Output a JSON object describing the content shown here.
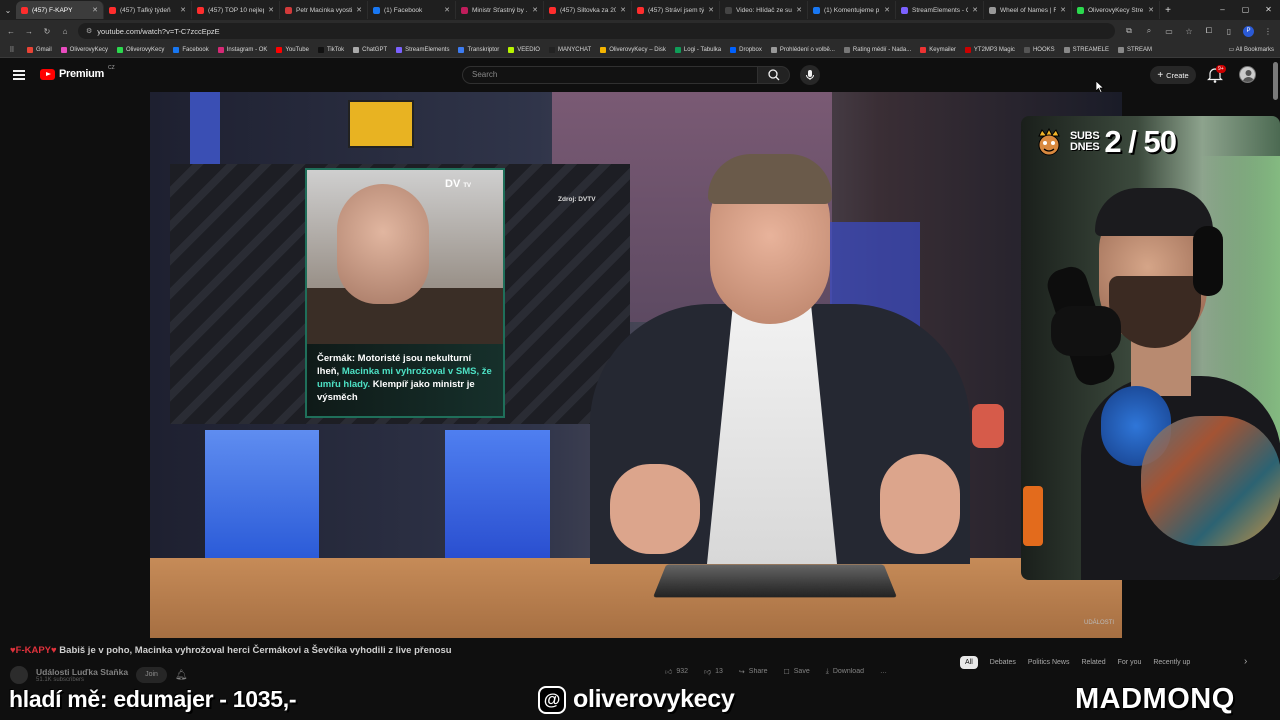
{
  "browser": {
    "tabs": [
      {
        "title": "(457) F-KAPY",
        "color": "#ff2d2d",
        "active": true
      },
      {
        "title": "(457) Ťafký týdeň",
        "color": "#ff2d2d"
      },
      {
        "title": "(457) TOP 10 nejlepš",
        "color": "#ff2d2d"
      },
      {
        "title": "Petr Macinka vyosti",
        "color": "#d23a3a"
      },
      {
        "title": "(1) Facebook",
        "color": "#1877f2"
      },
      {
        "title": "Ministr Šťastný by ...",
        "color": "#c01d5b"
      },
      {
        "title": "(457) Šiltovka za 20",
        "color": "#ff2d2d"
      },
      {
        "title": "(457) Stráví jsem tý",
        "color": "#ff2d2d"
      },
      {
        "title": "Video: Hlídač ze sup",
        "color": "#444"
      },
      {
        "title": "(1) Komentujeme p",
        "color": "#1877f2"
      },
      {
        "title": "StreamElements - C",
        "color": "#7b61ff"
      },
      {
        "title": "Wheel of Names | F",
        "color": "#999"
      },
      {
        "title": "OliverovyKecy Stre",
        "color": "#2bd94e"
      }
    ],
    "new_tab_label": "+",
    "window_controls": [
      "–",
      "▢",
      "✕"
    ],
    "url": "youtube.com/watch?v=T-C7zccEpzE",
    "bookmarks": [
      {
        "label": "Gmail",
        "color": "#ea4335"
      },
      {
        "label": "OliverovyKecy",
        "color": "#ea4cc0"
      },
      {
        "label": "OliverovyKecy",
        "color": "#2bd94e"
      },
      {
        "label": "Facebook",
        "color": "#1877f2"
      },
      {
        "label": "Instagram - OK",
        "color": "#d62976"
      },
      {
        "label": "YouTube",
        "color": "#ff0000"
      },
      {
        "label": "TikTok",
        "color": "#111"
      },
      {
        "label": "ChatGPT",
        "color": "#aaa"
      },
      {
        "label": "StreamElements",
        "color": "#7b61ff"
      },
      {
        "label": "Transkriptor",
        "color": "#3d7cf2"
      },
      {
        "label": "VEEDIO",
        "color": "#b8f500"
      },
      {
        "label": "MANYCHAT",
        "color": "#222"
      },
      {
        "label": "OliverovyKecy – Disk",
        "color": "#f4b400"
      },
      {
        "label": "Logi - Tabulka",
        "color": "#0f9d58"
      },
      {
        "label": "Dropbox",
        "color": "#0061ff"
      },
      {
        "label": "Prohlédení o volbě...",
        "color": "#999"
      },
      {
        "label": "Rating médií - Nada...",
        "color": "#777"
      },
      {
        "label": "Keymailer",
        "color": "#e33"
      },
      {
        "label": "YT2MP3 Magic",
        "color": "#c00"
      },
      {
        "label": "HOOKS",
        "color": "#555"
      },
      {
        "label": "STREAMELE",
        "color": "#888"
      },
      {
        "label": "STREAM",
        "color": "#888"
      }
    ],
    "all_bookmarks": "All Bookmarks"
  },
  "youtube": {
    "logo_text": "Premium",
    "logo_country": "CZ",
    "search_placeholder": "Search",
    "create_label": "Create",
    "notif_count": "9+",
    "video": {
      "tv_logo": "DV",
      "tv_logo_small": "TV",
      "source": "Zdroj: DVTV",
      "caption_parts": {
        "name": "Čermák:",
        "p1": " Motoristé jsou nekulturní lheň, ",
        "hl": "Macinka mi vyhrožoval v SMS, že umřu hlady.",
        "p2": " Klempíř jako ministr je výsměch"
      },
      "watermark": "UDÁLOSTI"
    },
    "title_hearts": "♥F-KAPY♥",
    "title_text": " Babiš je v poho, Macinka vyhrožoval herci Čermákovi a Ševčíka vyhodili z live přenosu",
    "channel_name": "Události Luďka Staňka",
    "channel_subs": "51.1K subscribers",
    "join_label": "Join",
    "actions": {
      "likes": "932",
      "dislikes": "13",
      "share": "Share",
      "save": "Save",
      "download": "Download",
      "more": "…"
    },
    "chips": [
      "All",
      "Debates",
      "Politics News",
      "Related",
      "For you",
      "Recently up"
    ]
  },
  "stream_overlay": {
    "subs_label_line1": "SUBS",
    "subs_label_line2": "DNES",
    "subs_current": 2,
    "subs_goal": 50,
    "subs_value": "2 / 50",
    "donation": "hladí mě: edumajer - 1035,-",
    "threads_handle": "oliverovykecy",
    "brand": "MADMONQ"
  }
}
